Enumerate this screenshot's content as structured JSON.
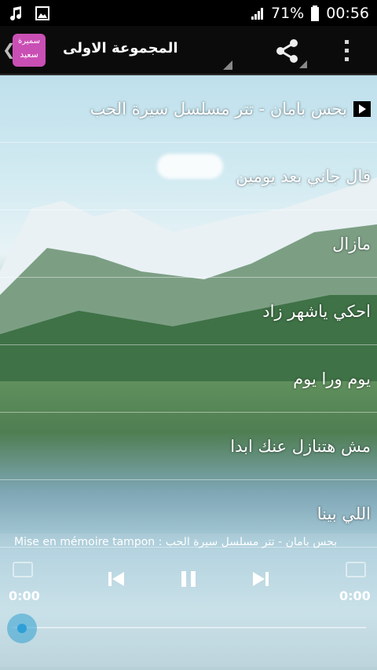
{
  "status_bar": {
    "battery_percent": "71%",
    "time": "00:56",
    "icons": [
      "music-note-icon",
      "image-icon",
      "signal-icon",
      "battery-icon"
    ]
  },
  "app_bar": {
    "icon_text_line1": "سميرة",
    "icon_text_line2": "سعيد",
    "title": "المجموعة الاولى",
    "icons": [
      "share-icon",
      "overflow-menu-icon"
    ]
  },
  "songs": [
    "بحس بامان - تتر مسلسل سيرة الحب",
    "قال جاني بعد يومين",
    "مازال",
    "احكي ياشهر زاد",
    "يوم ورا يوم",
    "مش هتنازل عنك ابدا",
    "اللي بينا"
  ],
  "player": {
    "buffering_text": "Mise en mémoire tampon : بحس بامان - تتر مسلسل سيرة الحب",
    "elapsed": "0:00",
    "duration": "0:00",
    "progress": 0,
    "accent_color": "#2f9fd8"
  }
}
